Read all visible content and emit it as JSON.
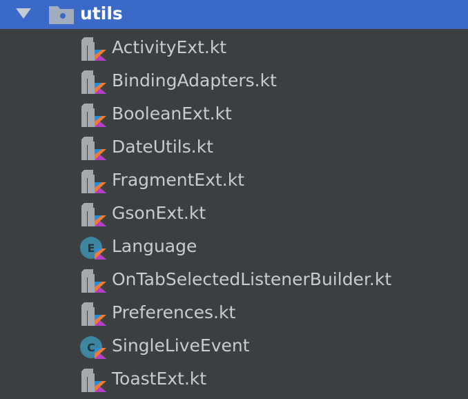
{
  "project_tree": {
    "folder": {
      "name": "utils",
      "expanded": true,
      "icon": "folder-icon",
      "selected_color": "#3a69c9"
    },
    "files": [
      {
        "name": "ActivityExt.kt",
        "icon": "kotlin-file-icon"
      },
      {
        "name": "BindingAdapters.kt",
        "icon": "kotlin-file-icon"
      },
      {
        "name": "BooleanExt.kt",
        "icon": "kotlin-file-icon"
      },
      {
        "name": "DateUtils.kt",
        "icon": "kotlin-file-icon"
      },
      {
        "name": "FragmentExt.kt",
        "icon": "kotlin-file-icon"
      },
      {
        "name": "GsonExt.kt",
        "icon": "kotlin-file-icon"
      },
      {
        "name": "Language",
        "icon": "kotlin-enum-icon"
      },
      {
        "name": "OnTabSelectedListenerBuilder.kt",
        "icon": "kotlin-file-icon"
      },
      {
        "name": "Preferences.kt",
        "icon": "kotlin-file-icon"
      },
      {
        "name": "SingleLiveEvent",
        "icon": "kotlin-class-icon"
      },
      {
        "name": "ToastExt.kt",
        "icon": "kotlin-file-icon"
      }
    ]
  }
}
